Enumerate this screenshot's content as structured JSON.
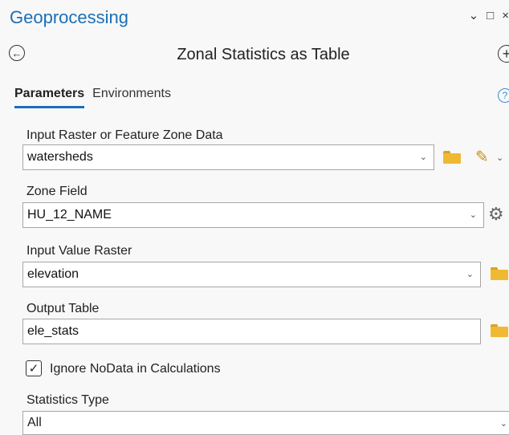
{
  "pane": {
    "title": "Geoprocessing",
    "controls": [
      "⌄",
      "□",
      "×"
    ]
  },
  "tool": {
    "title": "Zonal Statistics as Table",
    "back_icon": "←",
    "add_icon": "+"
  },
  "tabs": [
    {
      "label": "Parameters",
      "active": true
    },
    {
      "label": "Environments",
      "active": false
    }
  ],
  "help_icon": "?",
  "params": {
    "input_zone": {
      "label": "Input Raster or Feature Zone Data",
      "value": "watersheds"
    },
    "zone_field": {
      "label": "Zone Field",
      "value": "HU_12_NAME"
    },
    "value_raster": {
      "label": "Input Value Raster",
      "value": "elevation"
    },
    "output_table": {
      "label": "Output Table",
      "value": "ele_stats"
    },
    "ignore_nodata": {
      "label": "Ignore NoData in Calculations",
      "checked": true,
      "mark": "✓"
    },
    "stats_type": {
      "label": "Statistics Type",
      "value": "All"
    }
  },
  "glyphs": {
    "caret": "⌄",
    "pencil": "✎",
    "gear": "⚙"
  },
  "colors": {
    "accent": "#1b6fb8",
    "folder": "#f0b934"
  }
}
